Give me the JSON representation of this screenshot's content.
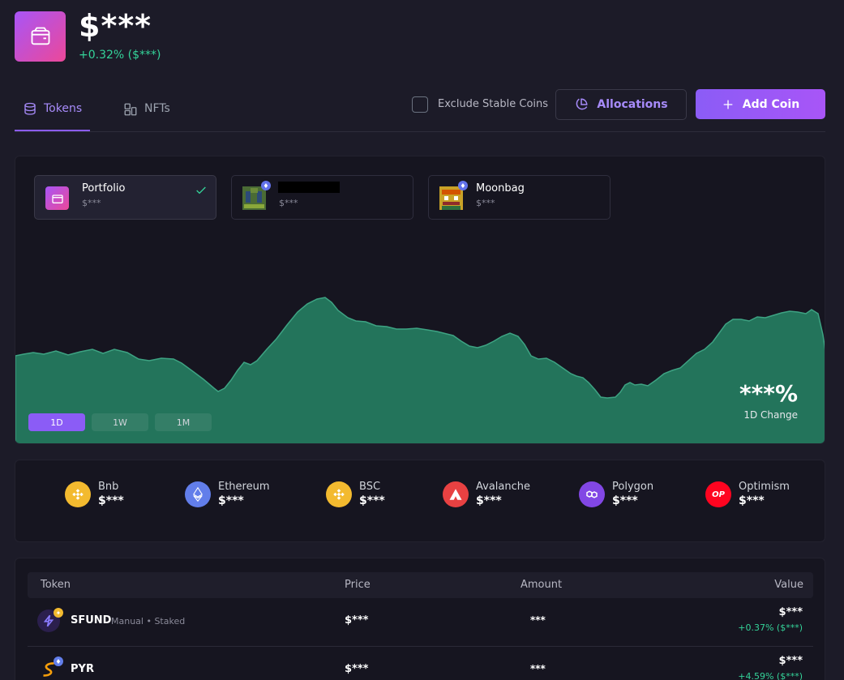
{
  "header": {
    "total_value": "$***",
    "change": "+0.32% ($***)"
  },
  "tabs": [
    {
      "label": "Tokens",
      "icon": "database-icon",
      "active": true
    },
    {
      "label": "NFTs",
      "icon": "grid-icon",
      "active": false
    }
  ],
  "toolbar": {
    "exclude_label": "Exclude Stable Coins",
    "exclude_checked": false,
    "allocations_label": "Allocations",
    "add_coin_label": "Add Coin"
  },
  "portfolios": [
    {
      "name": "Portfolio",
      "value": "$***",
      "selected": true
    },
    {
      "name": "",
      "value": "$***",
      "selected": false,
      "redacted": true
    },
    {
      "name": "Moonbag",
      "value": "$***",
      "selected": false
    }
  ],
  "chart": {
    "ranges": [
      "1D",
      "1W",
      "1M"
    ],
    "selected_range": "1D",
    "change_value": "***%",
    "change_label": "1D Change",
    "fill_color": "#23745b",
    "line_color": "#3ea383"
  },
  "chains": [
    {
      "name": "Bnb",
      "value": "$***",
      "color": "#f3ba2f",
      "icon": "bnb-icon"
    },
    {
      "name": "Ethereum",
      "value": "$***",
      "color": "#627eea",
      "icon": "ethereum-icon"
    },
    {
      "name": "BSC",
      "value": "$***",
      "color": "#f3ba2f",
      "icon": "bsc-icon"
    },
    {
      "name": "Avalanche",
      "value": "$***",
      "color": "#e84142",
      "icon": "avalanche-icon"
    },
    {
      "name": "Polygon",
      "value": "$***",
      "color": "#8247e5",
      "icon": "polygon-icon"
    },
    {
      "name": "Optimism",
      "value": "$***",
      "color": "#ff0420",
      "icon": "optimism-icon"
    }
  ],
  "table": {
    "headers": {
      "token": "Token",
      "price": "Price",
      "amount": "Amount",
      "value": "Value"
    },
    "rows": [
      {
        "symbol": "SFUND",
        "tag": "Manual • Staked",
        "price": "$***",
        "amount": "***",
        "value": "$***",
        "change": "+0.37% ($***)"
      },
      {
        "symbol": "PYR",
        "tag": "",
        "price": "$***",
        "amount": "***",
        "value": "$***",
        "change": "+4.59% ($***)"
      }
    ]
  }
}
